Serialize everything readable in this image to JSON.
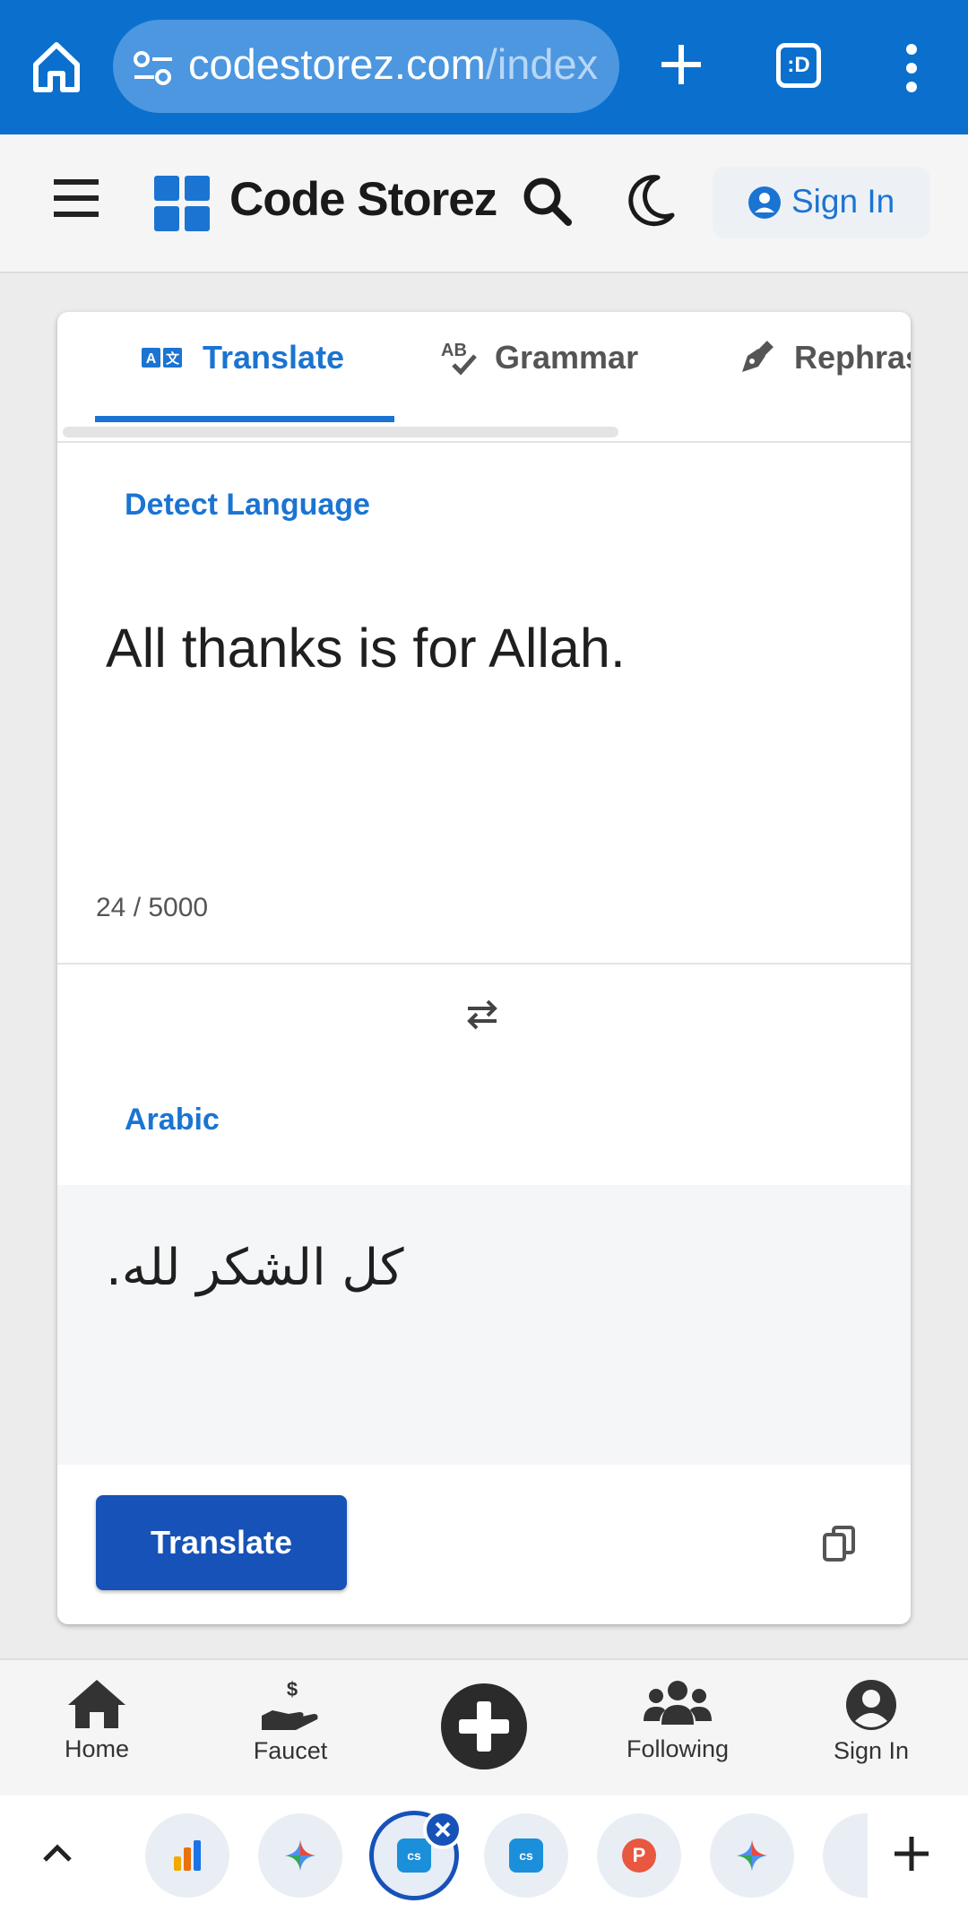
{
  "browser": {
    "url_domain": "codestorez.com",
    "url_path": "/index",
    "tab_count_label": ":D"
  },
  "header": {
    "brand": "Code Storez",
    "signin_label": "Sign In"
  },
  "tabs": [
    {
      "label": "Translate",
      "active": true
    },
    {
      "label": "Grammar",
      "active": false
    },
    {
      "label": "Rephras",
      "active": false
    }
  ],
  "translator": {
    "source_language": "Detect Language",
    "source_text": "All thanks is for Allah.",
    "char_count": "24 / 5000",
    "target_language": "Arabic",
    "result_text": "كل الشكر لله.",
    "translate_label": "Translate"
  },
  "bottom_nav": [
    {
      "label": "Home",
      "icon": "home-icon"
    },
    {
      "label": "Faucet",
      "icon": "faucet-icon"
    },
    {
      "label": "",
      "icon": "add-circle-icon"
    },
    {
      "label": "Following",
      "icon": "users-icon"
    },
    {
      "label": "Sign In",
      "icon": "user-circle-icon"
    }
  ],
  "tab_strip": {
    "cs_label": "cs",
    "p_label": "P"
  },
  "colors": {
    "browser_bar": "#0b6fce",
    "accent": "#1b74d2",
    "button": "#1652b8"
  }
}
